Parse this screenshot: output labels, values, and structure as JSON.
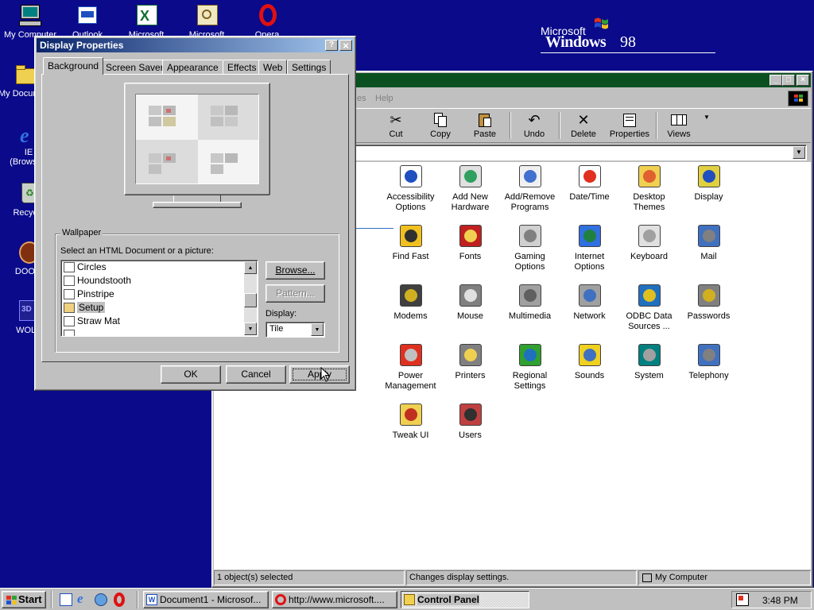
{
  "desktop": {
    "brand": {
      "microsoft": "Microsoft",
      "windows": "Windows",
      "version": "98"
    },
    "icons": [
      {
        "label": "My Computer",
        "icon": "computer-icon"
      },
      {
        "label": "Outlook",
        "icon": "outlook-icon"
      },
      {
        "label": "Microsoft",
        "icon": "excel-icon"
      },
      {
        "label": "Microsoft",
        "icon": "access-icon"
      },
      {
        "label": "Opera",
        "icon": "opera-icon"
      },
      {
        "label": "My Documents",
        "icon": "folder-icon"
      },
      {
        "label": "IE",
        "label2": "(Browser)",
        "icon": "ie-icon"
      },
      {
        "label": "Recycle",
        "icon": "recycle-icon"
      },
      {
        "label": "DOOM",
        "icon": "doom-icon"
      },
      {
        "label": "WOLF",
        "icon": "wolf-icon"
      }
    ]
  },
  "control_panel": {
    "menu_item": "Help",
    "menu_item_faded": "es",
    "toolbar": [
      {
        "label": "Cut",
        "icon": "scissors-icon"
      },
      {
        "label": "Copy",
        "icon": "copy-icon"
      },
      {
        "label": "Paste",
        "icon": "paste-icon"
      },
      {
        "label": "Undo",
        "icon": "undo-icon"
      },
      {
        "label": "Delete",
        "icon": "delete-icon"
      },
      {
        "label": "Properties",
        "icon": "properties-icon"
      },
      {
        "label": "Views",
        "icon": "views-icon"
      }
    ],
    "items": [
      {
        "line1": "Accessibility",
        "line2": "Options",
        "icon": "accessibility-icon"
      },
      {
        "line1": "Add New",
        "line2": "Hardware",
        "icon": "add-hardware-icon"
      },
      {
        "line1": "Add/Remove",
        "line2": "Programs",
        "icon": "add-remove-programs-icon"
      },
      {
        "line1": "Date/Time",
        "line2": "",
        "icon": "date-time-icon"
      },
      {
        "line1": "Desktop",
        "line2": "Themes",
        "icon": "desktop-themes-icon"
      },
      {
        "line1": "Display",
        "line2": "",
        "icon": "display-icon"
      },
      {
        "line1": "Find Fast",
        "line2": "",
        "icon": "find-fast-icon"
      },
      {
        "line1": "Fonts",
        "line2": "",
        "icon": "fonts-icon"
      },
      {
        "line1": "Gaming",
        "line2": "Options",
        "icon": "gaming-icon"
      },
      {
        "line1": "Internet",
        "line2": "Options",
        "icon": "internet-options-icon"
      },
      {
        "line1": "Keyboard",
        "line2": "",
        "icon": "keyboard-icon"
      },
      {
        "line1": "Mail",
        "line2": "",
        "icon": "mail-icon"
      },
      {
        "line1": "Modems",
        "line2": "",
        "icon": "modem-icon"
      },
      {
        "line1": "Mouse",
        "line2": "",
        "icon": "mouse-icon"
      },
      {
        "line1": "Multimedia",
        "line2": "",
        "icon": "multimedia-icon"
      },
      {
        "line1": "Network",
        "line2": "",
        "icon": "network-icon"
      },
      {
        "line1": "ODBC Data",
        "line2": "Sources ...",
        "icon": "odbc-icon"
      },
      {
        "line1": "Passwords",
        "line2": "",
        "icon": "passwords-icon"
      },
      {
        "line1": "Power",
        "line2": "Management",
        "icon": "power-icon"
      },
      {
        "line1": "Printers",
        "line2": "",
        "icon": "printers-icon"
      },
      {
        "line1": "Regional",
        "line2": "Settings",
        "icon": "regional-icon"
      },
      {
        "line1": "Sounds",
        "line2": "",
        "icon": "sounds-icon"
      },
      {
        "line1": "System",
        "line2": "",
        "icon": "system-icon"
      },
      {
        "line1": "Telephony",
        "line2": "",
        "icon": "telephony-icon"
      },
      {
        "line1": "Tweak UI",
        "line2": "",
        "icon": "tweak-ui-icon"
      },
      {
        "line1": "Users",
        "line2": "",
        "icon": "users-icon"
      }
    ],
    "status": {
      "selected": "1 object(s) selected",
      "description": "Changes display settings.",
      "location": "My Computer"
    }
  },
  "dialog": {
    "title": "Display Properties",
    "help": "?",
    "close": "×",
    "tabs": [
      "Background",
      "Screen Saver",
      "Appearance",
      "Effects",
      "Web",
      "Settings"
    ],
    "active_tab": "Background",
    "wallpaper": {
      "group_label": "Wallpaper",
      "prompt": "Select an HTML Document or a picture:",
      "items": [
        "Circles",
        "Houndstooth",
        "Pinstripe",
        "Setup",
        "Straw Mat"
      ],
      "selected": "Setup",
      "browse": "Browse...",
      "pattern": "Pattern...",
      "display_label": "Display:",
      "display_value": "Tile"
    },
    "buttons": {
      "ok": "OK",
      "cancel": "Cancel",
      "apply": "Apply"
    }
  },
  "taskbar": {
    "start": "Start",
    "tasks": [
      {
        "label": "Document1 - Microsof...",
        "icon": "word-icon"
      },
      {
        "label": "http://www.microsoft....",
        "icon": "opera-icon"
      },
      {
        "label": "Control Panel",
        "icon": "control-panel-icon",
        "active": true
      }
    ],
    "clock": "3:48 PM"
  },
  "colors": {
    "desktop": "#0a0a8a",
    "title_active": "#0a246a",
    "title_inactive": "#808080",
    "window": "#c0c0c0"
  }
}
